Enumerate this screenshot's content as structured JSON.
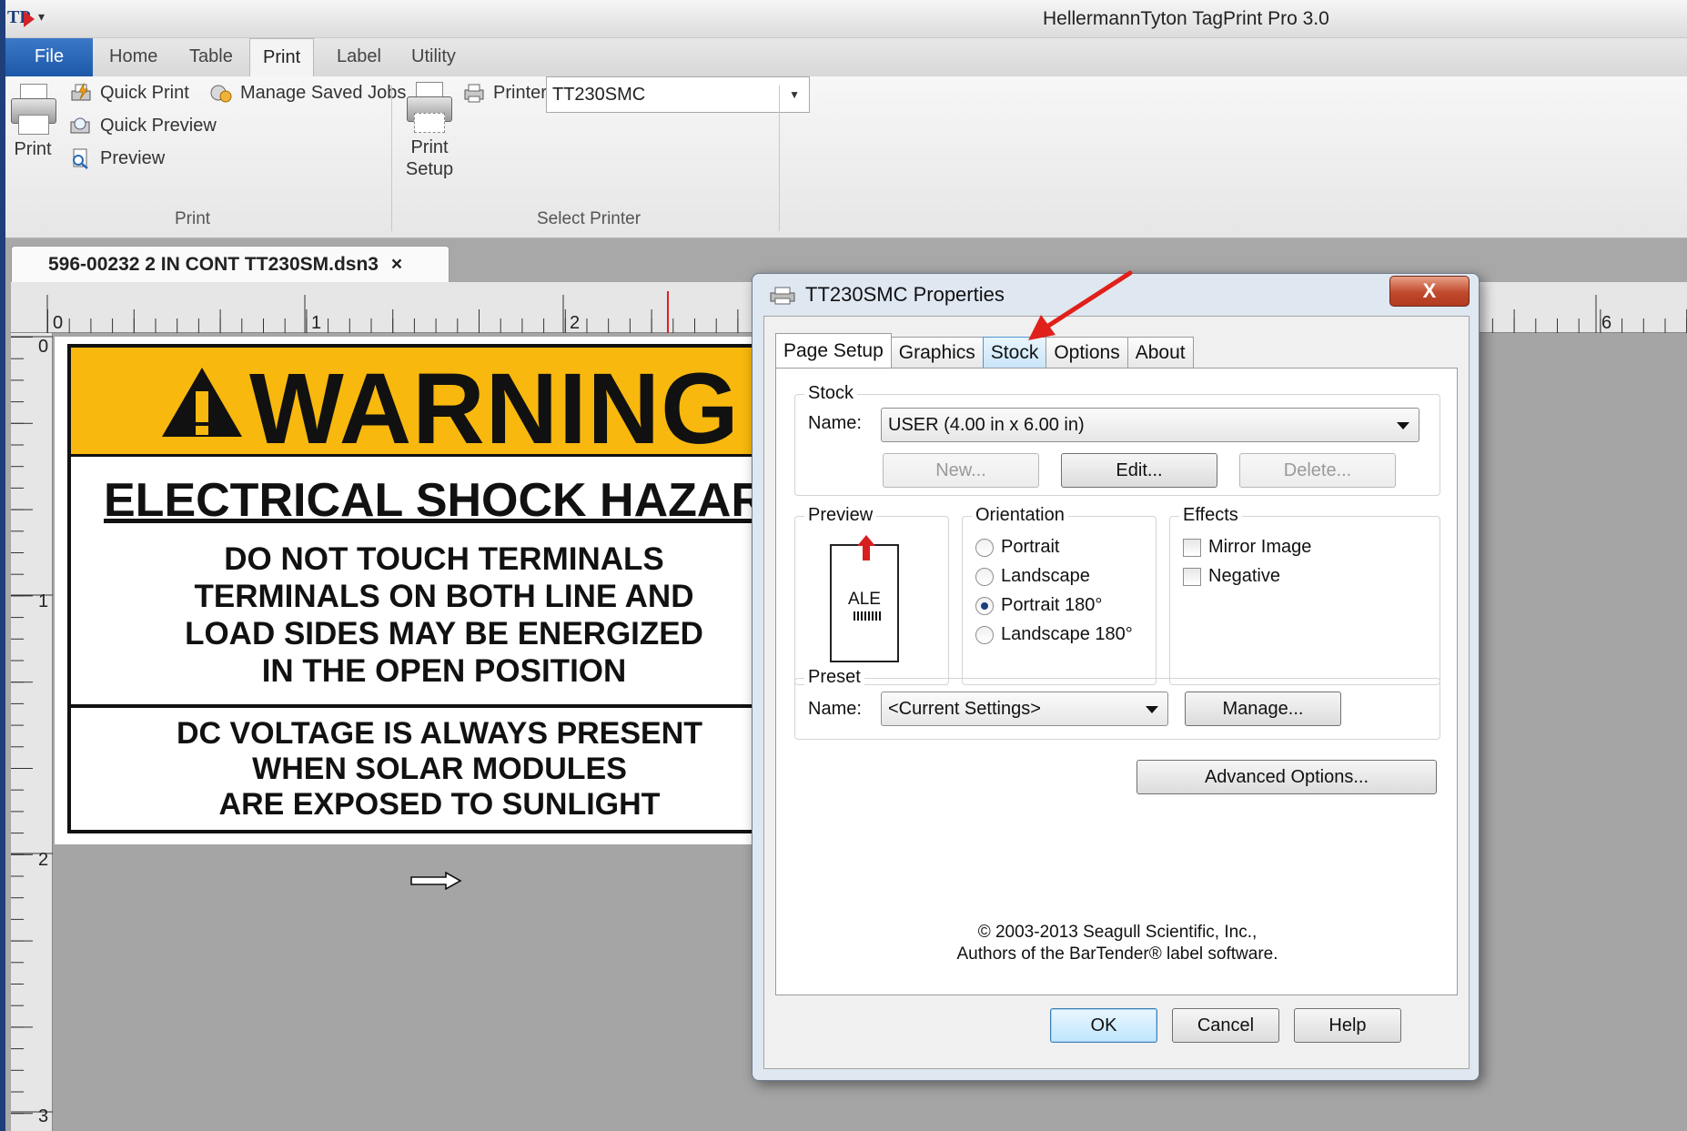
{
  "window": {
    "title": "HellermannTyton TagPrint Pro 3.0",
    "logo_text": "TP"
  },
  "ribbon": {
    "tabs": [
      {
        "label": "File"
      },
      {
        "label": "Home"
      },
      {
        "label": "Table"
      },
      {
        "label": "Print"
      },
      {
        "label": "Label"
      },
      {
        "label": "Utility"
      }
    ],
    "active_tab": "Print",
    "print_group": {
      "print_label": "Print",
      "quick_print": "Quick Print",
      "manage_saved_jobs": "Manage Saved Jobs",
      "quick_preview": "Quick Preview",
      "preview": "Preview",
      "group_label": "Print"
    },
    "select_printer_group": {
      "print_setup_line1": "Print",
      "print_setup_line2": "Setup",
      "printer_label": "Printer",
      "printer_value": "TT230SMC",
      "group_label": "Select Printer"
    }
  },
  "document": {
    "tab_label": "596-00232 2 IN CONT TT230SM.dsn3",
    "close_glyph": "×",
    "hruler_numbers": [
      "0",
      "1",
      "2",
      "6"
    ],
    "vruler_numbers": [
      "0",
      "1",
      "2",
      "3"
    ]
  },
  "label": {
    "heading": "WARNING",
    "hazard": "ELECTRICAL SHOCK HAZAR",
    "lines": [
      "DO NOT TOUCH TERMINALS",
      "TERMINALS ON BOTH LINE AND",
      "LOAD SIDES MAY BE ENERGIZED",
      "IN THE OPEN POSITION"
    ],
    "dc_lines": [
      "DC VOLTAGE IS ALWAYS PRESENT",
      "WHEN SOLAR MODULES",
      "ARE EXPOSED TO SUNLIGHT"
    ],
    "colors": {
      "header": "#f8b80d",
      "text": "#111111"
    }
  },
  "dialog": {
    "title": "TT230SMC Properties",
    "close_glyph": "X",
    "tabs": [
      {
        "label": "Page Setup"
      },
      {
        "label": "Graphics"
      },
      {
        "label": "Stock"
      },
      {
        "label": "Options"
      },
      {
        "label": "About"
      }
    ],
    "active_tab": "Page Setup",
    "highlighted_tab": "Stock",
    "stock": {
      "legend": "Stock",
      "name_label": "Name:",
      "name_value": "USER (4.00 in x 6.00 in)",
      "new_button": "New...",
      "edit_button": "Edit...",
      "delete_button": "Delete..."
    },
    "preview": {
      "legend": "Preview",
      "sample_text": "ALE"
    },
    "orientation": {
      "legend": "Orientation",
      "options": [
        {
          "label": "Portrait",
          "selected": false
        },
        {
          "label": "Landscape",
          "selected": false
        },
        {
          "label": "Portrait 180°",
          "selected": true
        },
        {
          "label": "Landscape 180°",
          "selected": false
        }
      ]
    },
    "effects": {
      "legend": "Effects",
      "options": [
        {
          "label": "Mirror Image",
          "checked": false
        },
        {
          "label": "Negative",
          "checked": false
        }
      ]
    },
    "preset": {
      "legend": "Preset",
      "name_label": "Name:",
      "name_value": "<Current Settings>",
      "manage_button": "Manage..."
    },
    "advanced_button": "Advanced Options...",
    "copyright_line1": "© 2003-2013 Seagull Scientific, Inc.,",
    "copyright_line2": "Authors of the BarTender® label software.",
    "ok_button": "OK",
    "cancel_button": "Cancel",
    "help_button": "Help"
  },
  "annotation": {
    "arrow_color": "#e0201a"
  }
}
